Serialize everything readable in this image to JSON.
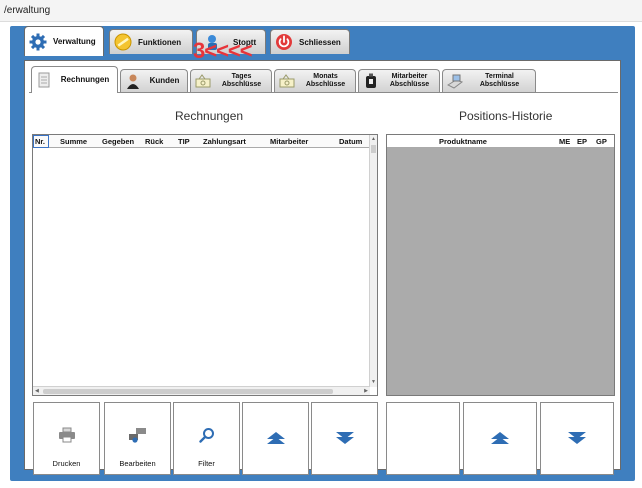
{
  "window": {
    "title": "/erwaltung"
  },
  "main_tabs": [
    {
      "label": "Verwaltung",
      "icon": "gear-icon",
      "active": true
    },
    {
      "label": "Funktionen",
      "icon": "coin-icon",
      "active": false
    },
    {
      "label": "Stoptt",
      "icon": "person-icon",
      "active": false
    },
    {
      "label": "Schliessen",
      "icon": "power-icon",
      "active": false
    }
  ],
  "annotation": {
    "text": "3<<<<",
    "color": "#e8343a"
  },
  "sub_tabs": [
    {
      "label": "Rechnungen",
      "icon": "document-icon",
      "active": true
    },
    {
      "label": "Kunden",
      "icon": "customer-icon",
      "active": false
    },
    {
      "label": "Tages\nAbschlüsse",
      "icon": "cash-icon",
      "active": false
    },
    {
      "label": "Monats\nAbschlüsse",
      "icon": "cash-icon",
      "active": false
    },
    {
      "label": "Mitarbeiter\nAbschlüsse",
      "icon": "employee-icon",
      "active": false
    },
    {
      "label": "Terminal\nAbschlüsse",
      "icon": "terminal-icon",
      "active": false
    }
  ],
  "left_section": {
    "title": "Rechnungen",
    "columns": [
      "Nr.",
      "Summe",
      "Gegeben",
      "Rück",
      "TIP",
      "Zahlungsart",
      "Mitarbeiter",
      "Datum"
    ],
    "rows": []
  },
  "right_section": {
    "title": "Positions-Historie",
    "columns": [
      "Produktname",
      "ME",
      "EP",
      "GP"
    ],
    "rows": []
  },
  "left_buttons": [
    {
      "label": "Drucken",
      "icon": "printer-icon"
    },
    {
      "label": "Bearbeiten",
      "icon": "edit-icon"
    },
    {
      "label": "Filter",
      "icon": "search-icon"
    },
    {
      "label": "",
      "icon": "up-icon"
    },
    {
      "label": "",
      "icon": "down-icon"
    }
  ],
  "right_buttons": [
    {
      "label": "",
      "icon": "blank"
    },
    {
      "label": "",
      "icon": "up-icon"
    },
    {
      "label": "",
      "icon": "down-icon"
    }
  ],
  "colors": {
    "frame": "#3f7fbf",
    "accent": "#2e6db4",
    "grid_bg": "#ababab"
  }
}
